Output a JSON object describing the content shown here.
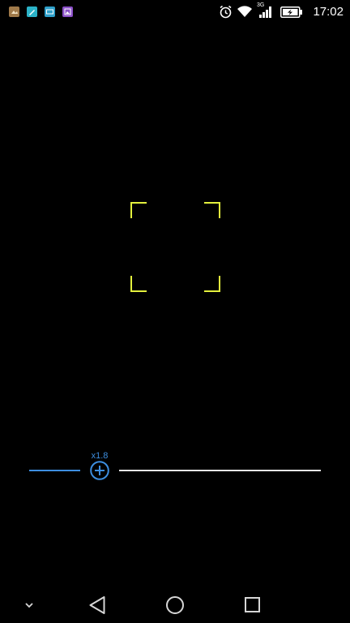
{
  "status_bar": {
    "time": "17:02",
    "network_type": "3G",
    "notification_icons": [
      "photo-app-icon",
      "edit-app-icon",
      "keyboard-app-icon",
      "gallery-app-icon"
    ],
    "colors": {
      "photo_app": "#a07a4a",
      "edit_app": "#2bb3c8",
      "keyboard_app": "#2e9fc9",
      "gallery_app": "#8a4fc7"
    }
  },
  "viewfinder": {
    "frame_color": "#e3f03d"
  },
  "zoom": {
    "label": "x1.8",
    "level": 1.8,
    "accent_color": "#3d8ee0"
  },
  "nav_bar": {
    "buttons": [
      "hide-nav-icon",
      "back-icon",
      "home-icon",
      "recents-icon"
    ]
  }
}
